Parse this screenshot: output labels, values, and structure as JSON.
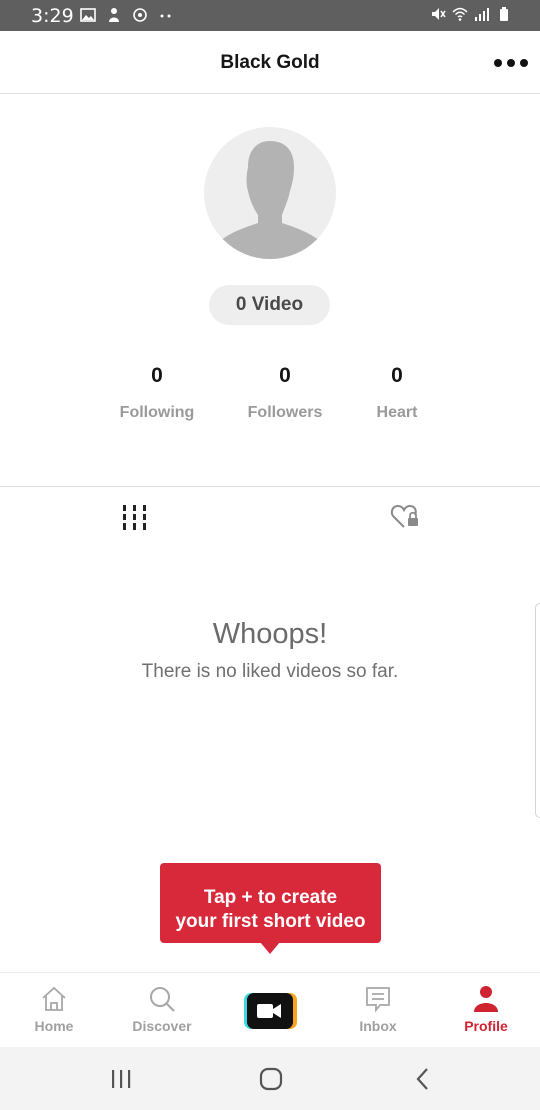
{
  "status_bar": {
    "time": "3:29",
    "left_icons": [
      "image-icon",
      "person-upload-icon",
      "sync-icon",
      "more-dots-icon"
    ],
    "right_icons": [
      "mute-icon",
      "wifi-icon",
      "signal-icon",
      "battery-icon"
    ]
  },
  "header": {
    "title": "Black Gold",
    "more_icon": "more-horizontal-icon"
  },
  "profile": {
    "avatar_icon": "default-avatar-icon",
    "video_count": "0 Video",
    "stats": [
      {
        "value": "0",
        "label": "Following"
      },
      {
        "value": "0",
        "label": "Followers"
      },
      {
        "value": "0",
        "label": "Heart"
      }
    ]
  },
  "tabs": [
    {
      "name": "videos",
      "icon": "grid-bars-icon"
    },
    {
      "name": "liked",
      "icon": "heart-lock-icon"
    }
  ],
  "empty_state": {
    "title": "Whoops!",
    "message": "There is no liked videos so far."
  },
  "tooltip": {
    "line1": "Tap + to create",
    "line2": "your first short video"
  },
  "bottom_nav": {
    "items": [
      {
        "label": "Home",
        "icon": "home-icon",
        "active": false
      },
      {
        "label": "Discover",
        "icon": "search-icon",
        "active": false
      },
      {
        "label": "",
        "icon": "video-camera-icon",
        "active": false
      },
      {
        "label": "Inbox",
        "icon": "message-icon",
        "active": false
      },
      {
        "label": "Profile",
        "icon": "person-icon",
        "active": true
      }
    ]
  },
  "colors": {
    "accent": "#d02330",
    "tooltip_bg": "#d8293a",
    "status_bar": "#5f5f5f",
    "muted_text": "#9a9a9a"
  }
}
